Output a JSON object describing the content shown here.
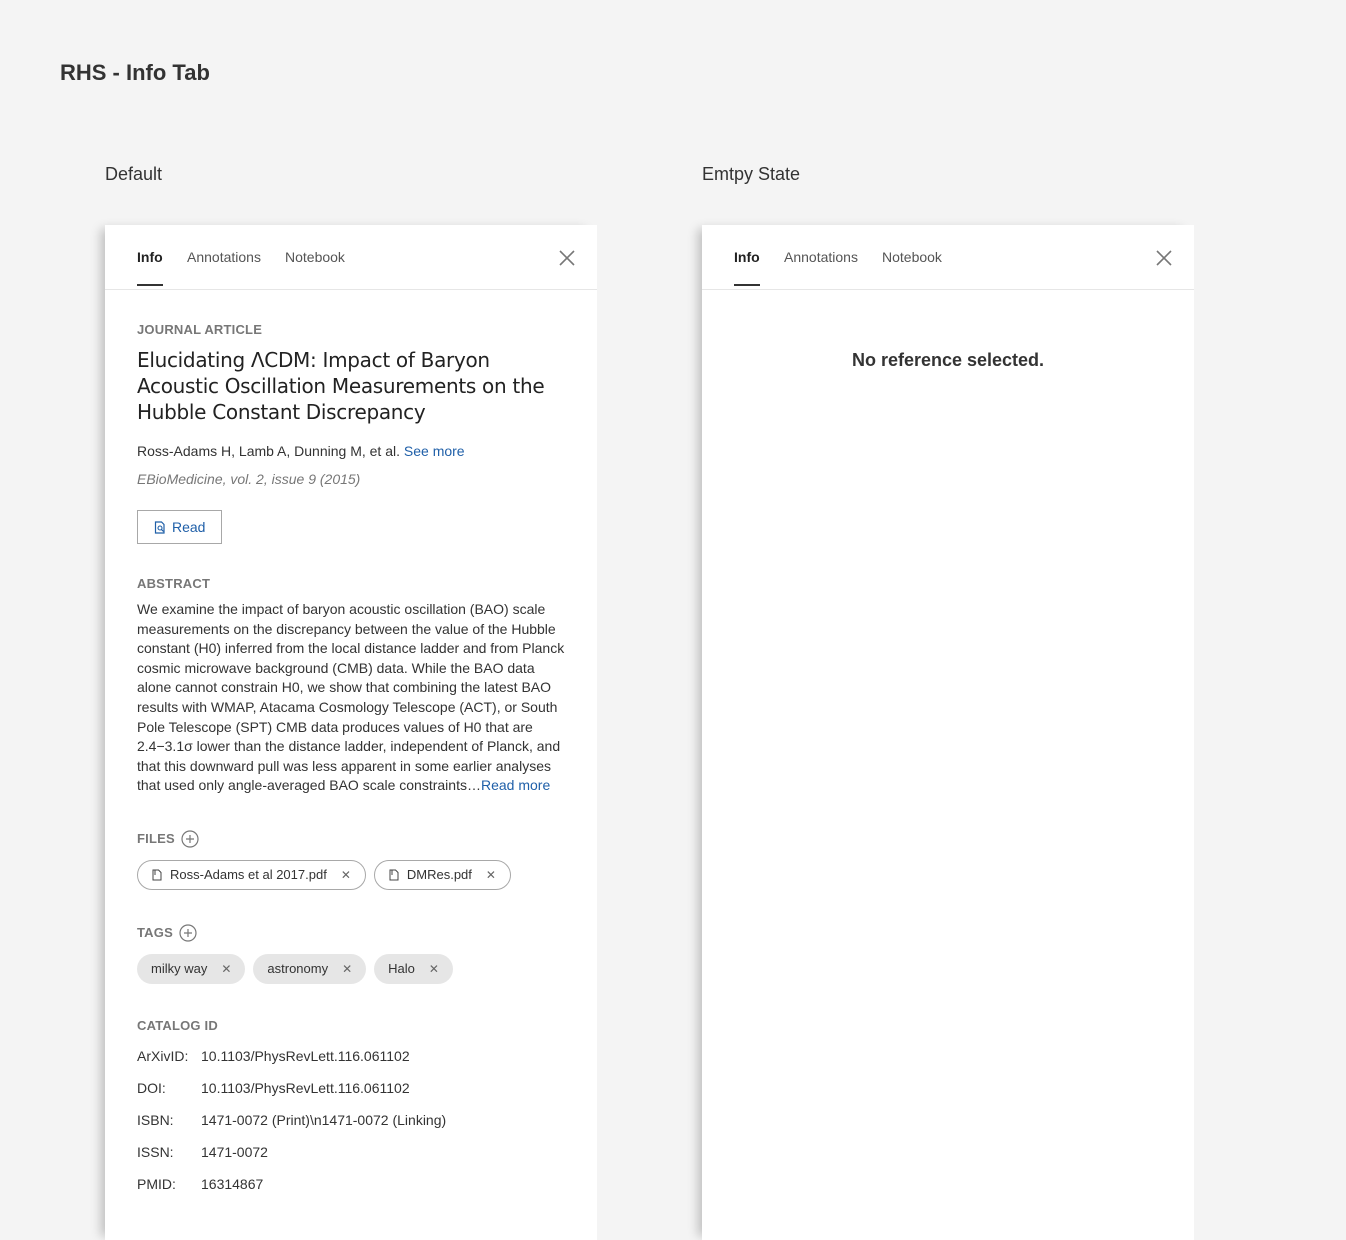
{
  "page": {
    "title": "RHS - Info Tab"
  },
  "variants": {
    "default_label": "Default",
    "empty_label": "Emtpy State"
  },
  "tabs": {
    "info": "Info",
    "annotations": "Annotations",
    "notebook": "Notebook"
  },
  "reference": {
    "type": "JOURNAL ARTICLE",
    "title": "Elucidating ΛCDM: Impact of Baryon Acoustic Oscillation Measurements on the Hubble Constant Discrepancy",
    "authors": "Ross-Adams H, Lamb A, Dunning M, et al.",
    "see_more": "See more",
    "citation": "EBioMedicine, vol. 2, issue 9 (2015)",
    "read_label": "Read",
    "abstract_label": "ABSTRACT",
    "abstract": "We examine the impact of baryon acoustic oscillation (BAO) scale measurements on the discrepancy between the value of the Hubble constant (H0) inferred from the local distance ladder and from Planck cosmic microwave background (CMB) data. While the BAO data alone cannot constrain H0, we show that combining the latest BAO results with WMAP, Atacama Cosmology Telescope (ACT), or South Pole Telescope (SPT) CMB data produces values of H0 that are 2.4−3.1σ lower than the distance ladder, independent of Planck, and that this downward pull was less apparent in some earlier analyses that used only angle-averaged BAO scale constraints…",
    "read_more": "Read more",
    "files_label": "FILES",
    "files": [
      "Ross-Adams et al 2017.pdf",
      "DMRes.pdf"
    ],
    "tags_label": "TAGS",
    "tags": [
      "milky way",
      "astronomy",
      "Halo"
    ],
    "catalog_label": "CATALOG ID",
    "catalog": [
      {
        "key": "ArXivID:",
        "value": "10.1103/PhysRevLett.116.061102"
      },
      {
        "key": "DOI:",
        "value": "10.1103/PhysRevLett.116.061102"
      },
      {
        "key": "ISBN:",
        "value": "1471-0072 (Print)\\n1471-0072 (Linking)"
      },
      {
        "key": "ISSN:",
        "value": "1471-0072"
      },
      {
        "key": "PMID:",
        "value": "16314867"
      }
    ]
  },
  "empty": {
    "message": "No reference selected."
  },
  "icons": {
    "close": "close-icon",
    "add": "add-circle-icon",
    "file": "file-icon",
    "read": "document-read-icon",
    "remove": "remove-x-icon"
  },
  "colors": {
    "link": "#1f5fa8",
    "background": "#f4f4f4",
    "panel": "#ffffff",
    "tag_bg": "#e6e6e6"
  }
}
